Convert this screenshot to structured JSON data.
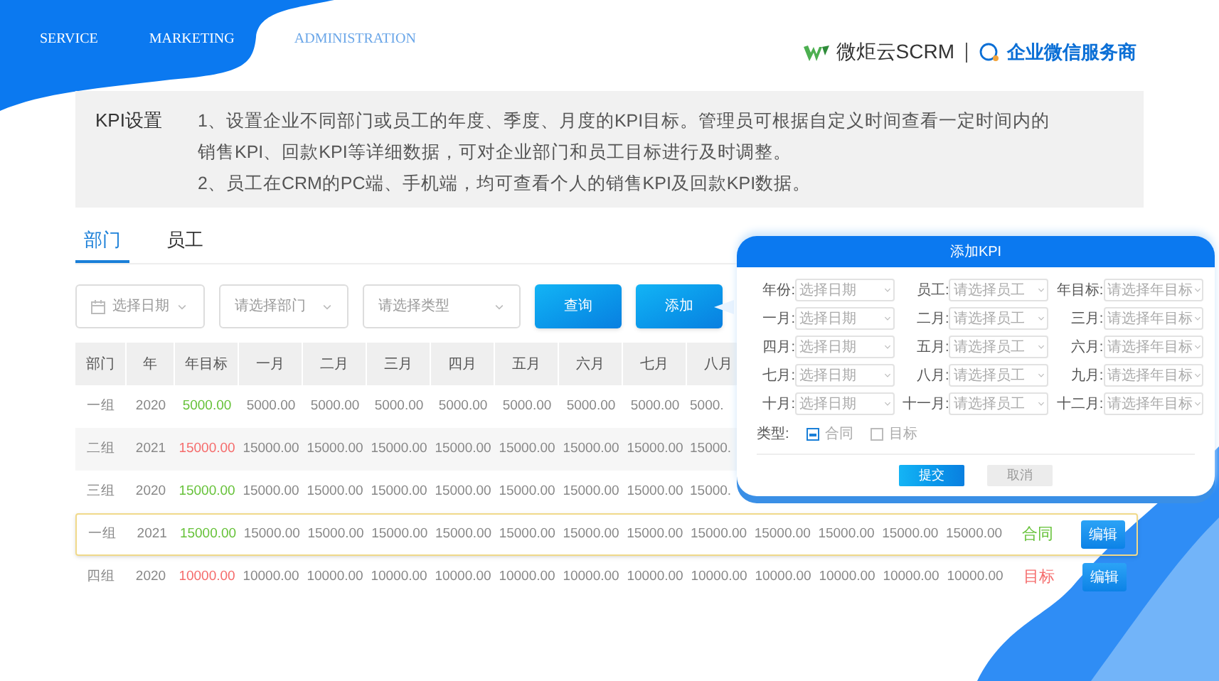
{
  "nav": [
    {
      "label": "SERVICE",
      "selected": false
    },
    {
      "label": "MARKETING",
      "selected": false
    },
    {
      "label": "ADMINISTRATION",
      "selected": true
    }
  ],
  "logo": {
    "name": "微炬云SCRM",
    "tagline": "企业微信服务商"
  },
  "intro": {
    "title": "KPI设置",
    "points": [
      "1、设置企业不同部门或员工的年度、季度、月度的KPI目标。管理员可根据自定义时间查看一定时间内的销售KPI、回款KPI等详细数据，可对企业部门和员工目标进行及时调整。",
      "2、员工在CRM的PC端、手机端，均可查看个人的销售KPI及回款KPI数据。"
    ]
  },
  "tabs": [
    {
      "label": "部门",
      "selected": true
    },
    {
      "label": "员工",
      "selected": false
    }
  ],
  "filters": [
    {
      "kind": "date",
      "placeholder": "选择日期"
    },
    {
      "kind": "select",
      "placeholder": "请选择部门"
    },
    {
      "kind": "select",
      "placeholder": "请选择类型"
    }
  ],
  "buttons": [
    "查询",
    "添加"
  ],
  "table": {
    "columns": [
      "部门",
      "年",
      "年目标",
      "一月",
      "二月",
      "三月",
      "四月",
      "五月",
      "六月",
      "七月",
      "八月"
    ],
    "rows": [
      {
        "selected": false,
        "color": "#67c23a",
        "cells": [
          "一组",
          "2020",
          "5000.00",
          "5000.00",
          "5000.00",
          "5000.00",
          "5000.00",
          "5000.00",
          "5000.00",
          "5000.00",
          "5000."
        ]
      },
      {
        "selected": false,
        "color": "#f56c6c",
        "cells": [
          "二组",
          "2021",
          "15000.00",
          "15000.00",
          "15000.00",
          "15000.00",
          "15000.00",
          "15000.00",
          "15000.00",
          "15000.00",
          "15000."
        ]
      },
      {
        "selected": false,
        "color": "#67c23a",
        "cells": [
          "三组",
          "2020",
          "15000.00",
          "15000.00",
          "15000.00",
          "15000.00",
          "15000.00",
          "15000.00",
          "15000.00",
          "15000.00",
          "15000."
        ]
      },
      {
        "selected": true,
        "color": "#67c23a",
        "cells": [
          "一组",
          "2021",
          "15000.00",
          "15000.00",
          "15000.00",
          "15000.00",
          "15000.00",
          "15000.00",
          "15000.00",
          "15000.00",
          "15000.00",
          "15000.00",
          "15000.00",
          "15000.00",
          "15000.00",
          "合同"
        ],
        "action": "编辑"
      },
      {
        "selected": false,
        "color": "#f56c6c",
        "cells": [
          "四组",
          "2020",
          "10000.00",
          "10000.00",
          "10000.00",
          "10000.00",
          "10000.00",
          "10000.00",
          "10000.00",
          "10000.00",
          "10000.00",
          "10000.00",
          "10000.00",
          "10000.00",
          "10000.00",
          "目标"
        ],
        "action": "编辑"
      }
    ]
  },
  "dialog": {
    "title": "添加KPI",
    "fields": [
      {
        "label": "年份:",
        "placeholder": "选择日期"
      },
      {
        "label": "员工:",
        "placeholder": "请选择员工"
      },
      {
        "label": "年目标:",
        "placeholder": "请选择年目标"
      },
      {
        "label": "一月:",
        "placeholder": "选择日期"
      },
      {
        "label": "二月:",
        "placeholder": "请选择员工"
      },
      {
        "label": "三月:",
        "placeholder": "请选择年目标"
      },
      {
        "label": "四月:",
        "placeholder": "选择日期"
      },
      {
        "label": "五月:",
        "placeholder": "请选择员工"
      },
      {
        "label": "六月:",
        "placeholder": "请选择年目标"
      },
      {
        "label": "七月:",
        "placeholder": "选择日期"
      },
      {
        "label": "八月:",
        "placeholder": "请选择员工"
      },
      {
        "label": "九月:",
        "placeholder": "请选择年目标"
      },
      {
        "label": "十月:",
        "placeholder": "选择日期"
      },
      {
        "label": "十一月:",
        "placeholder": "请选择员工"
      },
      {
        "label": "十二月:",
        "placeholder": "请选择年目标"
      }
    ],
    "type_label": "类型:",
    "types": [
      {
        "label": "合同",
        "checked": true
      },
      {
        "label": "目标",
        "checked": false
      }
    ],
    "buttons": [
      "提交",
      "取消"
    ]
  }
}
